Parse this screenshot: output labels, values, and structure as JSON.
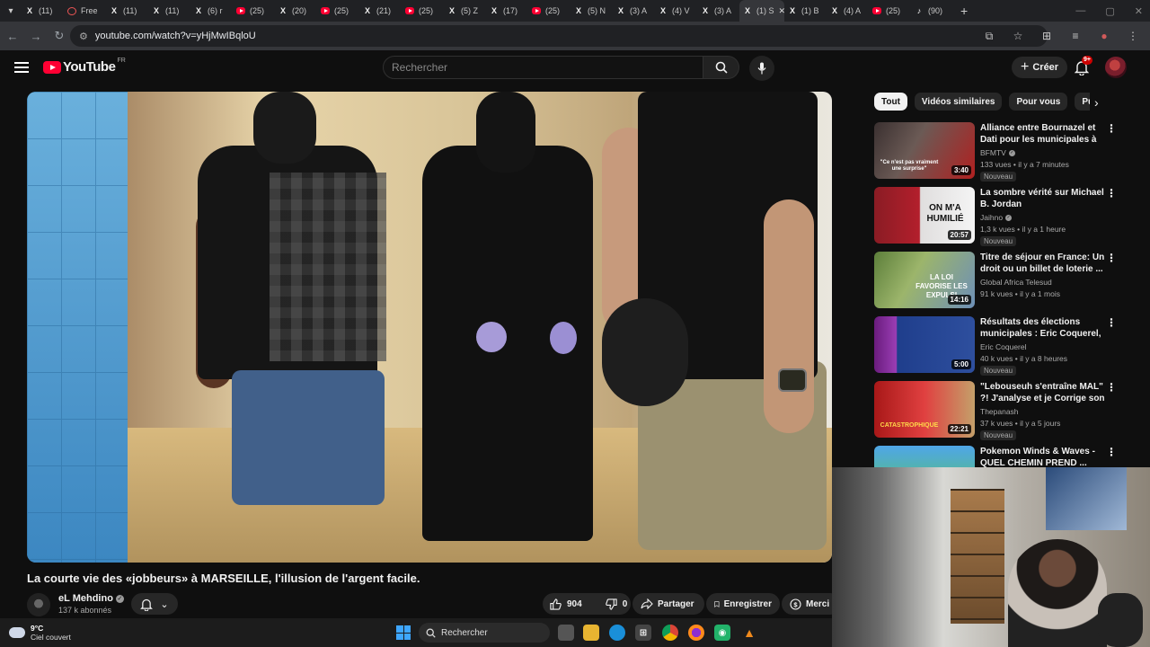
{
  "browser": {
    "tabs": [
      {
        "icon": "x-icon",
        "label": "(11)"
      },
      {
        "icon": "circle-icon",
        "label": "Free"
      },
      {
        "icon": "x-icon",
        "label": "(11)"
      },
      {
        "icon": "x-icon",
        "label": "(11)"
      },
      {
        "icon": "x-icon",
        "label": "(6) r"
      },
      {
        "icon": "youtube-icon",
        "label": "(25)"
      },
      {
        "icon": "x-icon",
        "label": "(20)"
      },
      {
        "icon": "youtube-icon",
        "label": "(25)"
      },
      {
        "icon": "x-icon",
        "label": "(21)"
      },
      {
        "icon": "youtube-icon",
        "label": "(25)"
      },
      {
        "icon": "x-icon",
        "label": "(5) Z"
      },
      {
        "icon": "x-icon",
        "label": "(17)"
      },
      {
        "icon": "youtube-icon",
        "label": "(25)"
      },
      {
        "icon": "x-icon",
        "label": "(5) N"
      },
      {
        "icon": "x-icon",
        "label": "(3) A"
      },
      {
        "icon": "x-icon",
        "label": "(4) V"
      },
      {
        "icon": "x-icon",
        "label": "(3) A"
      },
      {
        "icon": "x-icon",
        "label": "(1) S"
      },
      {
        "icon": "x-icon",
        "label": "(1) B"
      },
      {
        "icon": "x-icon",
        "label": "(4) A"
      },
      {
        "icon": "youtube-icon",
        "label": "(25)"
      },
      {
        "icon": "tiktok-icon",
        "label": "(90)"
      }
    ],
    "url": "youtube.com/watch?v=yHjMwIBqloU"
  },
  "masthead": {
    "logo_text": "YouTube",
    "country_code": "FR",
    "search_placeholder": "Rechercher",
    "create_label": "Créer",
    "notification_count": "9+"
  },
  "video": {
    "title": "La courte vie des «jobbeurs» à MARSEILLE, l'illusion de l'argent facile.",
    "channel": "eL Mehdino",
    "subscribers": "137 k abonnés",
    "likes": "904",
    "dislikes": "0",
    "share_label": "Partager",
    "save_label": "Enregistrer",
    "thanks_label": "Merci"
  },
  "sidebar": {
    "chips": [
      "Tout",
      "Vidéos similaires",
      "Pour vous",
      "Publié"
    ],
    "recommendations": [
      {
        "title": "Alliance entre Bournazel et Dati pour les municipales à Paris: l...",
        "channel": "BFMTV",
        "verified": true,
        "meta": "133 vues • il y a 7 minutes",
        "duration": "3:40",
        "badge": "Nouveau",
        "thumb_text": "\"Ce n'est pas vraiment une surprise\""
      },
      {
        "title": "La sombre vérité sur Michael B. Jordan",
        "channel": "Jaihno",
        "verified": true,
        "meta": "1,3 k vues • il y a 1 heure",
        "duration": "20:57",
        "badge": "Nouveau",
        "thumb_text": "ON M'A HUMILIÉ"
      },
      {
        "title": "Titre de séjour en France: Un droit ou un billet de loterie ...",
        "channel": "Global Africa Telesud",
        "verified": false,
        "meta": "91 k vues • il y a 1 mois",
        "duration": "14:16",
        "badge": "",
        "thumb_text": "LA LOI FAVORISE LES EXPULSI"
      },
      {
        "title": "Résultats des élections municipales : Eric Coquerel, ...",
        "channel": "Eric Coquerel",
        "verified": false,
        "meta": "40 k vues • il y a 8 heures",
        "duration": "5:00",
        "badge": "Nouveau",
        "thumb_text": ""
      },
      {
        "title": "\"Lebouseuh s'entraîne MAL\" ?! J'analyse et je Corrige son ...",
        "channel": "Thepanash",
        "verified": false,
        "meta": "37 k vues • il y a 5 jours",
        "duration": "22:21",
        "badge": "Nouveau",
        "thumb_text": "CATASTROPHIQUE"
      },
      {
        "title": "Pokemon Winds & Waves - QUEL CHEMIN PREND ...",
        "channel": "",
        "verified": false,
        "meta": "",
        "duration": "",
        "badge": "",
        "thumb_text": ""
      }
    ]
  },
  "taskbar": {
    "temperature": "9°C",
    "weather": "Ciel couvert",
    "search_label": "Rechercher"
  },
  "colors": {
    "background": "#0f0f0f",
    "brand_red": "#ff0033",
    "chip_active_bg": "#f1f1f1",
    "secondary_text": "#aaaaaa"
  }
}
